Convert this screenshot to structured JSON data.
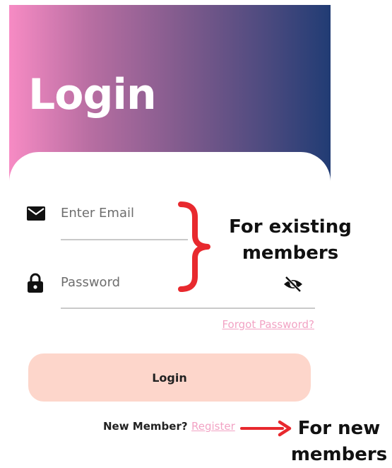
{
  "header": {
    "title": "Login"
  },
  "form": {
    "email_placeholder": "Enter Email",
    "password_placeholder": "Password",
    "forgot_label": "Forgot Password?",
    "login_label": "Login"
  },
  "footer": {
    "new_member_label": "New Member?",
    "register_label": "Register"
  },
  "annotations": {
    "existing_line1": "For existing",
    "existing_line2": "members",
    "new_line1": "For new",
    "new_line2": "members"
  },
  "icons": {
    "email": "envelope-icon",
    "password": "lock-icon",
    "visibility": "eye-off-icon"
  },
  "colors": {
    "gradient_start": "#f78bc4",
    "gradient_end": "#213c74",
    "link": "#f2a3c4",
    "button_bg": "#fdd6cb",
    "annotation_red": "#e8292e"
  }
}
